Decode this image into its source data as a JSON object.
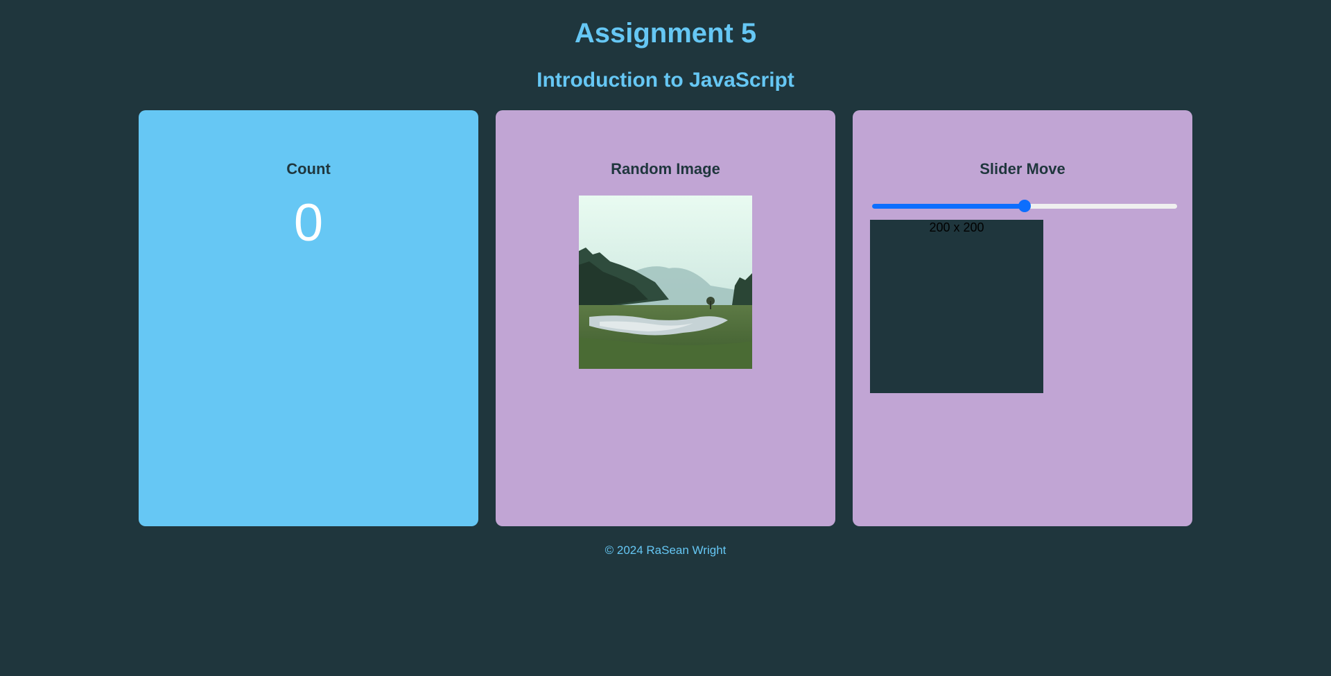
{
  "header": {
    "title": "Assignment 5",
    "subtitle": "Introduction to JavaScript"
  },
  "cards": {
    "count": {
      "title": "Count",
      "value": "0"
    },
    "random_image": {
      "title": "Random Image"
    },
    "slider": {
      "title": "Slider Move",
      "value_fraction": 0.5,
      "box_label": "200 x 200"
    }
  },
  "footer": {
    "text": "© 2024 RaSean Wright"
  },
  "colors": {
    "background": "#1f363d",
    "accent": "#66c7f4",
    "card_purple": "#c1a5d4",
    "slider_blue": "#0d6efd"
  }
}
